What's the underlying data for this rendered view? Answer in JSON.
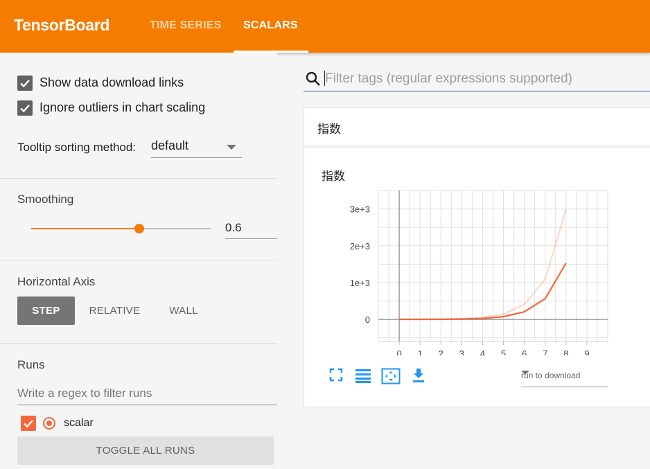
{
  "app": {
    "title": "TensorBoard"
  },
  "tabs": [
    {
      "label": "TIME SERIES"
    },
    {
      "label": "SCALARS"
    }
  ],
  "settings": {
    "show_download_links": {
      "label": "Show data download links",
      "checked": true
    },
    "ignore_outliers": {
      "label": "Ignore outliers in chart scaling",
      "checked": true
    },
    "tooltip_sorting": {
      "label": "Tooltip sorting method:",
      "value": "default"
    }
  },
  "smoothing": {
    "title": "Smoothing",
    "value": "0.6",
    "slider_fraction": 0.6
  },
  "horizontal_axis": {
    "title": "Horizontal Axis",
    "options": [
      "STEP",
      "RELATIVE",
      "WALL"
    ],
    "selected": "STEP"
  },
  "runs": {
    "title": "Runs",
    "filter_placeholder": "Write a regex to filter runs",
    "items": [
      {
        "name": "scalar",
        "checked": true,
        "color": "#f4683c"
      }
    ],
    "toggle_label": "TOGGLE ALL RUNS"
  },
  "search": {
    "placeholder": "Filter tags (regular expressions supported)"
  },
  "group": {
    "title": "指数"
  },
  "card": {
    "title": "指数",
    "download_select": "run to download",
    "icons": [
      "fullscreen-icon",
      "toggle-log-scale-icon",
      "fit-domain-icon",
      "download-icon"
    ]
  },
  "chart_data": {
    "type": "line",
    "title": "指数",
    "xlim": [
      -1,
      10
    ],
    "ylim": [
      -600,
      3500
    ],
    "xticks": [
      0,
      1,
      2,
      3,
      4,
      5,
      6,
      7,
      8,
      9
    ],
    "xtick_labels": [
      "0",
      "1",
      "2",
      "3",
      "4",
      "5",
      "6",
      "7",
      "8",
      "9"
    ],
    "yticks": [
      0,
      1000,
      2000,
      3000
    ],
    "ytick_labels": [
      "0",
      "1e+3",
      "2e+3",
      "3e+3"
    ],
    "grid": true,
    "series": [
      {
        "name": "scalar",
        "color": "#f4683c",
        "opacity": 0.25,
        "x": [
          0,
          1,
          2,
          3,
          4,
          5,
          6,
          7,
          8
        ],
        "y": [
          1,
          3,
          7,
          20,
          55,
          148,
          403,
          1097,
          2981
        ]
      },
      {
        "name": "scalar",
        "color": "#f4683c",
        "opacity": 1,
        "x": [
          0,
          1,
          2,
          3,
          4,
          5,
          6,
          7,
          8
        ],
        "y": [
          1,
          1.8,
          3.9,
          10.4,
          28.1,
          76,
          207,
          562,
          1529
        ]
      }
    ]
  }
}
